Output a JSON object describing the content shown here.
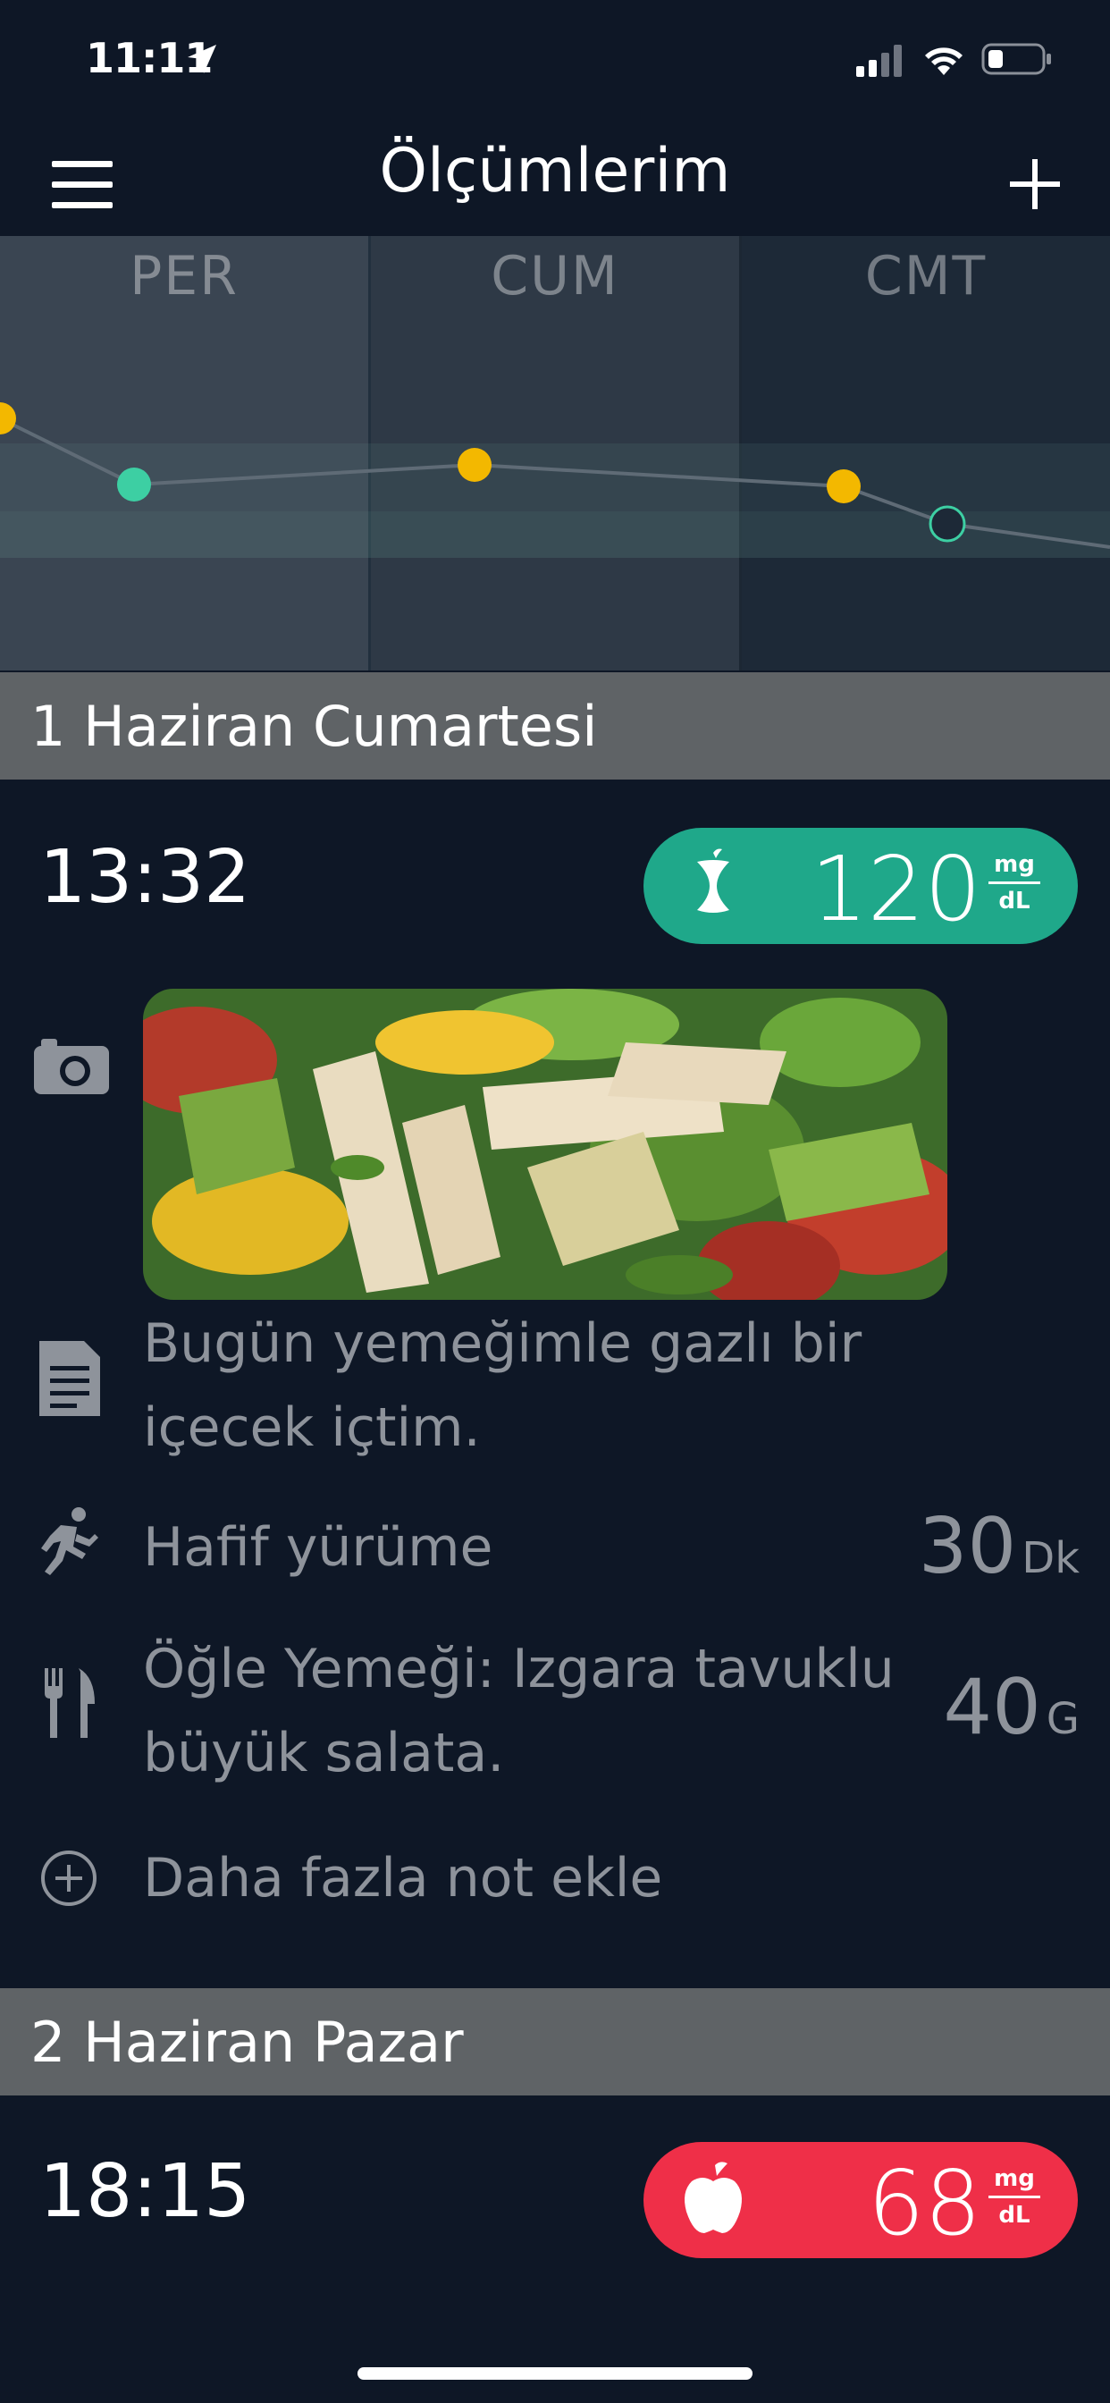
{
  "status_bar": {
    "time": "11:11"
  },
  "nav": {
    "title": "Ölçümlerim"
  },
  "chart": {
    "day_labels": [
      "PER",
      "CUM",
      "CMT"
    ]
  },
  "chart_data": {
    "type": "scatter",
    "categories": [
      "PER",
      "CUM",
      "CMT"
    ],
    "series": [
      {
        "points": [
          {
            "day": "PER",
            "status": "high"
          },
          {
            "day": "PER",
            "status": "normal"
          },
          {
            "day": "CUM",
            "status": "high"
          },
          {
            "day": "CMT",
            "status": "high"
          },
          {
            "day": "CMT",
            "status": "normal-outline"
          }
        ]
      }
    ],
    "colors": {
      "high": "#f3b800",
      "normal": "#3dcfa3"
    },
    "grid": false
  },
  "days": [
    {
      "header": "1 Haziran Cumartesi",
      "entry": {
        "time": "13:32",
        "reading": {
          "value": "120",
          "unit_top": "mg",
          "unit_bottom": "dL",
          "color": "#1fa88a",
          "icon": "apple-core-icon"
        },
        "notes": [
          {
            "icon": "document-icon",
            "text_line1": "Bugün yemeğimle gazlı bir",
            "text_line2": "içecek içtim."
          },
          {
            "icon": "running-icon",
            "text": "Hafif yürüme",
            "value": "30",
            "unit": "Dk"
          },
          {
            "icon": "fork-knife-icon",
            "text_line1": "Öğle Yemeği: Izgara tavuklu",
            "text_line2": "büyük salata.",
            "value": "40",
            "unit": "G"
          },
          {
            "icon": "plus-circle-icon",
            "text": "Daha fazla not ekle"
          }
        ]
      }
    },
    {
      "header": "2 Haziran Pazar",
      "entry": {
        "time": "18:15",
        "reading": {
          "value": "68",
          "unit_top": "mg",
          "unit_bottom": "dL",
          "color": "#ef2f48",
          "icon": "apple-icon"
        }
      }
    }
  ]
}
